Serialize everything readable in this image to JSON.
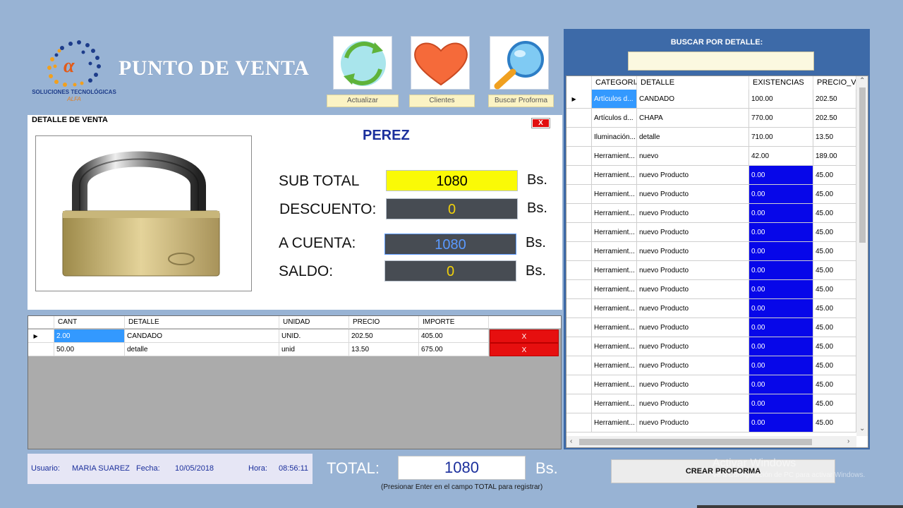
{
  "app": {
    "title": "PUNTO DE VENTA",
    "logo_text": "SOLUCIONES TECNOLÓGICAS",
    "logo_sub": "ALFA"
  },
  "toolbar": {
    "buttons": [
      {
        "label": "Actualizar",
        "icon": "refresh-icon"
      },
      {
        "label": "Clientes",
        "icon": "heart-icon"
      },
      {
        "label": "Buscar Proforma",
        "icon": "magnifier-icon"
      }
    ]
  },
  "detail": {
    "title": "DETALLE DE VENTA",
    "close_label": "X",
    "client_name": "PEREZ",
    "subtotal_label": "SUB TOTAL",
    "subtotal_value": "1080",
    "descuento_label": "DESCUENTO:",
    "descuento_value": "0",
    "acuenta_label": "A CUENTA:",
    "acuenta_value": "1080",
    "saldo_label": "SALDO:",
    "saldo_value": "0",
    "currency": "Bs."
  },
  "sale_table": {
    "headers": [
      "CANT",
      "DETALLE",
      "UNIDAD",
      "PRECIO",
      "IMPORTE"
    ],
    "rows": [
      {
        "cant": "2.00",
        "detalle": "CANDADO",
        "unidad": "UNID.",
        "precio": "202.50",
        "importe": "405.00",
        "delete": "X"
      },
      {
        "cant": "50.00",
        "detalle": "detalle",
        "unidad": "unid",
        "precio": "13.50",
        "importe": "675.00",
        "delete": "X"
      }
    ]
  },
  "footer": {
    "usuario_label": "Usuario:",
    "usuario_value": "MARIA SUAREZ",
    "fecha_label": "Fecha:",
    "fecha_value": "10/05/2018",
    "hora_label": "Hora:",
    "hora_value": "08:56:11",
    "total_label": "TOTAL:",
    "total_value": "1080",
    "total_currency": "Bs.",
    "hint": "(Presionar Enter en el campo TOTAL para registrar)",
    "crear_label": "CREAR PROFORMA",
    "watermark_line1": "Activar Windows",
    "watermark_line2": "Ve a Configuración de PC para activar Windows."
  },
  "products": {
    "search_label": "BUSCAR POR DETALLE:",
    "search_value": "",
    "headers": [
      "CATEGORIA",
      "DETALLE",
      "EXISTENCIAS",
      "PRECIO_VE"
    ],
    "rows": [
      {
        "categoria": "Artículos d...",
        "detalle": "CANDADO",
        "existencias": "100.00",
        "precio": "202.50",
        "low": false
      },
      {
        "categoria": "Artículos d...",
        "detalle": "CHAPA",
        "existencias": "770.00",
        "precio": "202.50",
        "low": false
      },
      {
        "categoria": "Iluminación...",
        "detalle": "detalle",
        "existencias": "710.00",
        "precio": "13.50",
        "low": false
      },
      {
        "categoria": "Herramient...",
        "detalle": "nuevo",
        "existencias": "42.00",
        "precio": "189.00",
        "low": false
      },
      {
        "categoria": "Herramient...",
        "detalle": "nuevo Producto",
        "existencias": "0.00",
        "precio": "45.00",
        "low": true
      },
      {
        "categoria": "Herramient...",
        "detalle": "nuevo Producto",
        "existencias": "0.00",
        "precio": "45.00",
        "low": true
      },
      {
        "categoria": "Herramient...",
        "detalle": "nuevo Producto",
        "existencias": "0.00",
        "precio": "45.00",
        "low": true
      },
      {
        "categoria": "Herramient...",
        "detalle": "nuevo Producto",
        "existencias": "0.00",
        "precio": "45.00",
        "low": true
      },
      {
        "categoria": "Herramient...",
        "detalle": "nuevo Producto",
        "existencias": "0.00",
        "precio": "45.00",
        "low": true
      },
      {
        "categoria": "Herramient...",
        "detalle": "nuevo Producto",
        "existencias": "0.00",
        "precio": "45.00",
        "low": true
      },
      {
        "categoria": "Herramient...",
        "detalle": "nuevo Producto",
        "existencias": "0.00",
        "precio": "45.00",
        "low": true
      },
      {
        "categoria": "Herramient...",
        "detalle": "nuevo Producto",
        "existencias": "0.00",
        "precio": "45.00",
        "low": true
      },
      {
        "categoria": "Herramient...",
        "detalle": "nuevo Producto",
        "existencias": "0.00",
        "precio": "45.00",
        "low": true
      },
      {
        "categoria": "Herramient...",
        "detalle": "nuevo Producto",
        "existencias": "0.00",
        "precio": "45.00",
        "low": true
      },
      {
        "categoria": "Herramient...",
        "detalle": "nuevo Producto",
        "existencias": "0.00",
        "precio": "45.00",
        "low": true
      },
      {
        "categoria": "Herramient...",
        "detalle": "nuevo Producto",
        "existencias": "0.00",
        "precio": "45.00",
        "low": true
      },
      {
        "categoria": "Herramient...",
        "detalle": "nuevo Producto",
        "existencias": "0.00",
        "precio": "45.00",
        "low": true
      },
      {
        "categoria": "Herramient...",
        "detalle": "nuevo Producto",
        "existencias": "0.00",
        "precio": "45.00",
        "low": true
      }
    ]
  },
  "colors": {
    "background": "#98b3d4",
    "subtotal_bg": "#fafa06",
    "dark_field": "#474c53",
    "low_stock": "#0707e9",
    "delete_button": "#e60f0f",
    "selected_cell": "#3399ff",
    "panel_blue": "#3d6aa8"
  }
}
